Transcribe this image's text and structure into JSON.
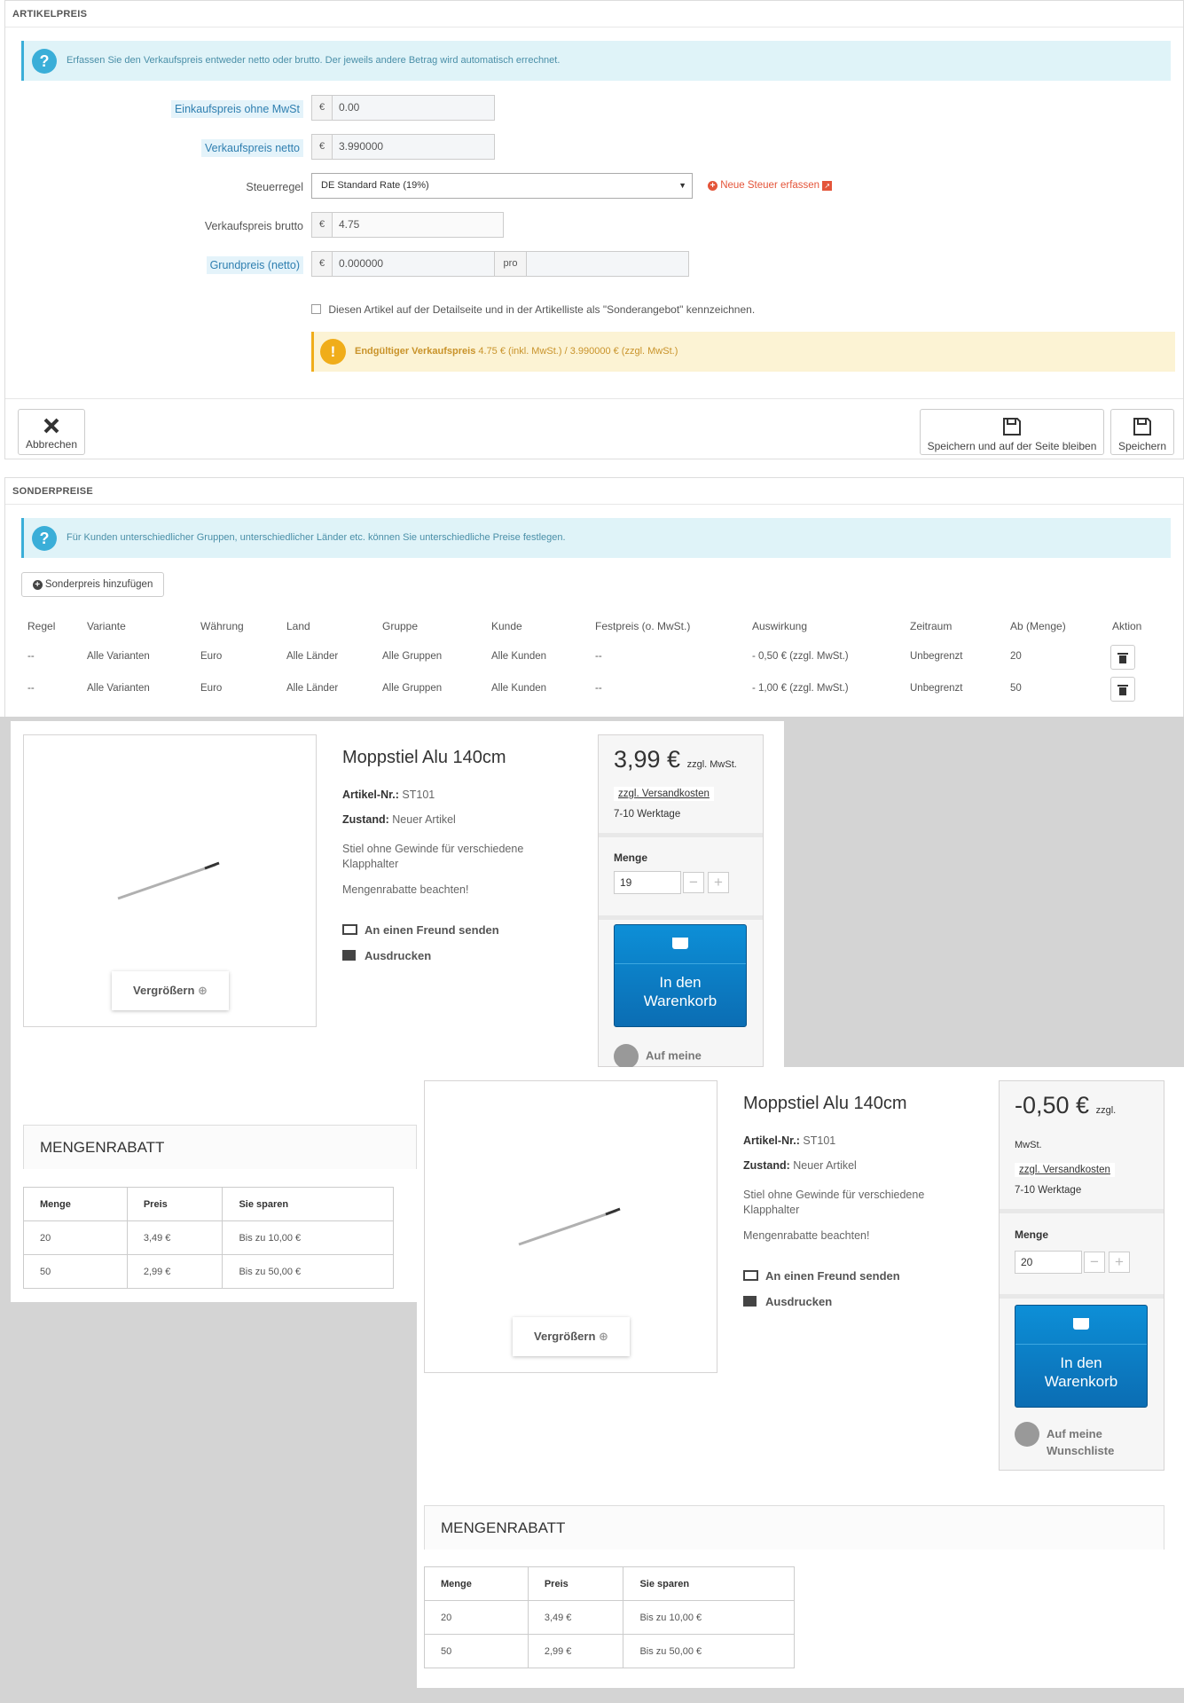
{
  "admin": {
    "articlepreis": {
      "title": "ARTIKELPREIS",
      "info": "Erfassen Sie den Verkaufspreis entweder netto oder brutto. Der jeweils andere Betrag wird automatisch errechnet.",
      "einkauf_label": "Einkaufspreis ohne MwSt",
      "einkauf_value": "0.00",
      "netto_label": "Verkaufspreis netto",
      "netto_value": "3.990000",
      "steuer_label": "Steuerregel",
      "steuer_value": "DE Standard Rate (19%)",
      "neue_steuer": "Neue Steuer erfassen",
      "brutto_label": "Verkaufspreis brutto",
      "brutto_value": "4.75",
      "grund_label": "Grundpreis (netto)",
      "grund_value": "0.000000",
      "grund_pro": "pro",
      "currency": "€",
      "sonder_check": "Diesen Artikel auf der Detailseite und in der Artikelliste als \"Sonderangebot\" kennzeichnen.",
      "final_label": "Endgültiger Verkaufspreis",
      "final_value": "4.75 € (inkl. MwSt.) / 3.990000 € (zzgl. MwSt.)",
      "cancel": "Abbrechen",
      "save_stay": "Speichern und auf der Seite bleiben",
      "save": "Speichern"
    },
    "sonderpreise": {
      "title": "SONDERPREISE",
      "info": "Für Kunden unterschiedlicher Gruppen, unterschiedlicher Länder etc. können Sie unterschiedliche Preise festlegen.",
      "add": "Sonderpreis hinzufügen",
      "headers": [
        "Regel",
        "Variante",
        "Währung",
        "Land",
        "Gruppe",
        "Kunde",
        "Festpreis (o. MwSt.)",
        "Auswirkung",
        "Zeitraum",
        "Ab (Menge)",
        "Aktion"
      ],
      "rows": [
        [
          "--",
          "Alle Varianten",
          "Euro",
          "Alle Länder",
          "Alle Gruppen",
          "Alle Kunden",
          "--",
          "- 0,50 € (zzgl. MwSt.)",
          "Unbegrenzt",
          "20"
        ],
        [
          "--",
          "Alle Varianten",
          "Euro",
          "Alle Länder",
          "Alle Gruppen",
          "Alle Kunden",
          "--",
          "- 1,00 € (zzgl. MwSt.)",
          "Unbegrenzt",
          "50"
        ]
      ]
    }
  },
  "shop1": {
    "title": "Moppstiel Alu 140cm",
    "sku_label": "Artikel-Nr.:",
    "sku": "ST101",
    "cond_label": "Zustand:",
    "cond": "Neuer Artikel",
    "desc": "Stiel ohne Gewinde für verschiedene Klapphalter",
    "note": "Mengenrabatte beachten!",
    "send": "An einen Freund senden",
    "print": "Ausdrucken",
    "zoom": "Vergrößern",
    "price": "3,99 €",
    "price_suffix": "zzgl. MwSt.",
    "shipping": "zzgl. Versandkosten",
    "delivery": "7-10 Werktage",
    "qty_label": "Menge",
    "qty": "19",
    "cart": "In den Warenkorb",
    "wish": "Auf meine",
    "mr_title": "MENGENRABATT",
    "mr_headers": [
      "Menge",
      "Preis",
      "Sie sparen"
    ],
    "mr_rows": [
      [
        "20",
        "3,49 €",
        "Bis zu 10,00 €"
      ],
      [
        "50",
        "2,99 €",
        "Bis zu 50,00 €"
      ]
    ]
  },
  "shop2": {
    "title": "Moppstiel Alu 140cm",
    "sku_label": "Artikel-Nr.:",
    "sku": "ST101",
    "cond_label": "Zustand:",
    "cond": "Neuer Artikel",
    "desc": "Stiel ohne Gewinde für verschiedene Klapphalter",
    "note": "Mengenrabatte beachten!",
    "send": "An einen Freund senden",
    "print": "Ausdrucken",
    "zoom": "Vergrößern",
    "price": "-0,50 €",
    "price_suffix": "zzgl.",
    "price_suffix2": "MwSt.",
    "shipping": "zzgl. Versandkosten",
    "delivery": "7-10 Werktage",
    "qty_label": "Menge",
    "qty": "20",
    "cart": "In den Warenkorb",
    "wish": "Auf meine Wunschliste",
    "mr_title": "MENGENRABATT",
    "mr_headers": [
      "Menge",
      "Preis",
      "Sie sparen"
    ],
    "mr_rows": [
      [
        "20",
        "3,49 €",
        "Bis zu 10,00 €"
      ],
      [
        "50",
        "2,99 €",
        "Bis zu 50,00 €"
      ]
    ]
  },
  "colors": {
    "accent": "#3aaed8",
    "cart": "#0b7dc4",
    "warning": "#f0ad1a",
    "danger": "#e4553a"
  }
}
